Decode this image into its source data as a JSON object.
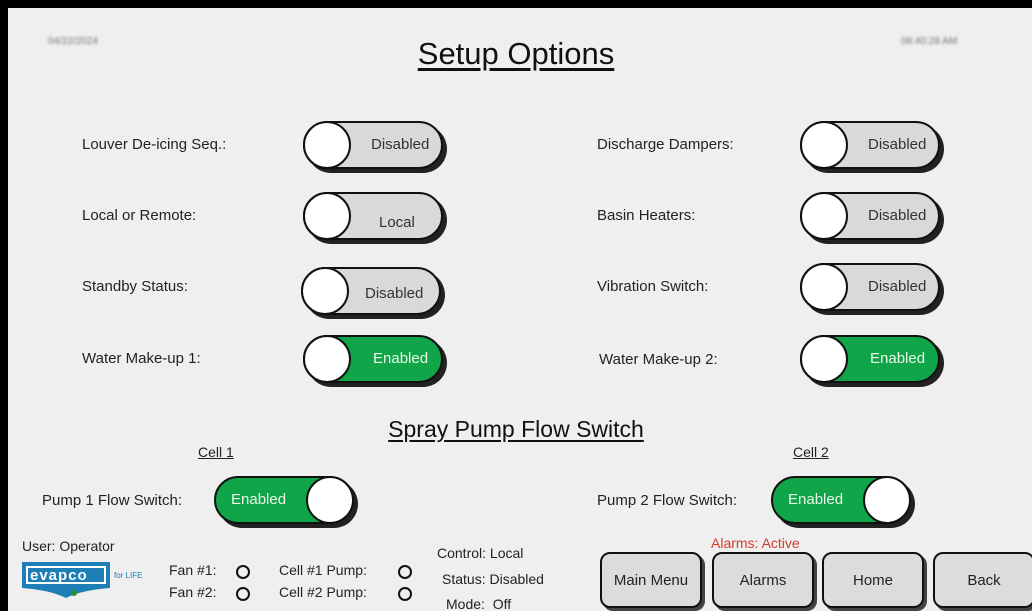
{
  "header": {
    "date": "04/22/2024",
    "time": "08:40:28 AM",
    "title": "Setup Options"
  },
  "toggles_left": [
    {
      "label": "Louver De-icing Seq.:",
      "state": "Disabled"
    },
    {
      "label": "Local or Remote:",
      "state": "Local"
    },
    {
      "label": "Standby Status:",
      "state": "Disabled"
    },
    {
      "label": "Water Make-up 1:",
      "state": "Enabled"
    }
  ],
  "toggles_right": [
    {
      "label": "Discharge Dampers:",
      "state": "Disabled"
    },
    {
      "label": "Basin Heaters:",
      "state": "Disabled"
    },
    {
      "label": "Vibration Switch:",
      "state": "Disabled"
    },
    {
      "label": "Water Make-up 2:",
      "state": "Enabled"
    }
  ],
  "flow": {
    "title": "Spray Pump Flow Switch",
    "cell1": {
      "title": "Cell 1",
      "label": "Pump 1 Flow Switch:",
      "state": "Enabled"
    },
    "cell2": {
      "title": "Cell 2",
      "label": "Pump 2 Flow Switch:",
      "state": "Enabled"
    }
  },
  "footer": {
    "user": "User: Operator",
    "logo_text": "evapco",
    "logo_tag": "for LIFE",
    "fan1": "Fan #1:",
    "fan2": "Fan #2:",
    "cell1_pump": "Cell #1 Pump:",
    "cell2_pump": "Cell #2 Pump:",
    "control": "Control: Local",
    "status": "Status: Disabled",
    "mode": "Mode:  Off",
    "alarms_status": "Alarms: Active",
    "buttons": [
      "Main Menu",
      "Alarms",
      "Home",
      "Back"
    ]
  },
  "colors": {
    "enabled": "#0fa548",
    "disabled": "#d9d9d9",
    "alarm": "#d23b2b",
    "logo": "#1d7fb5"
  }
}
